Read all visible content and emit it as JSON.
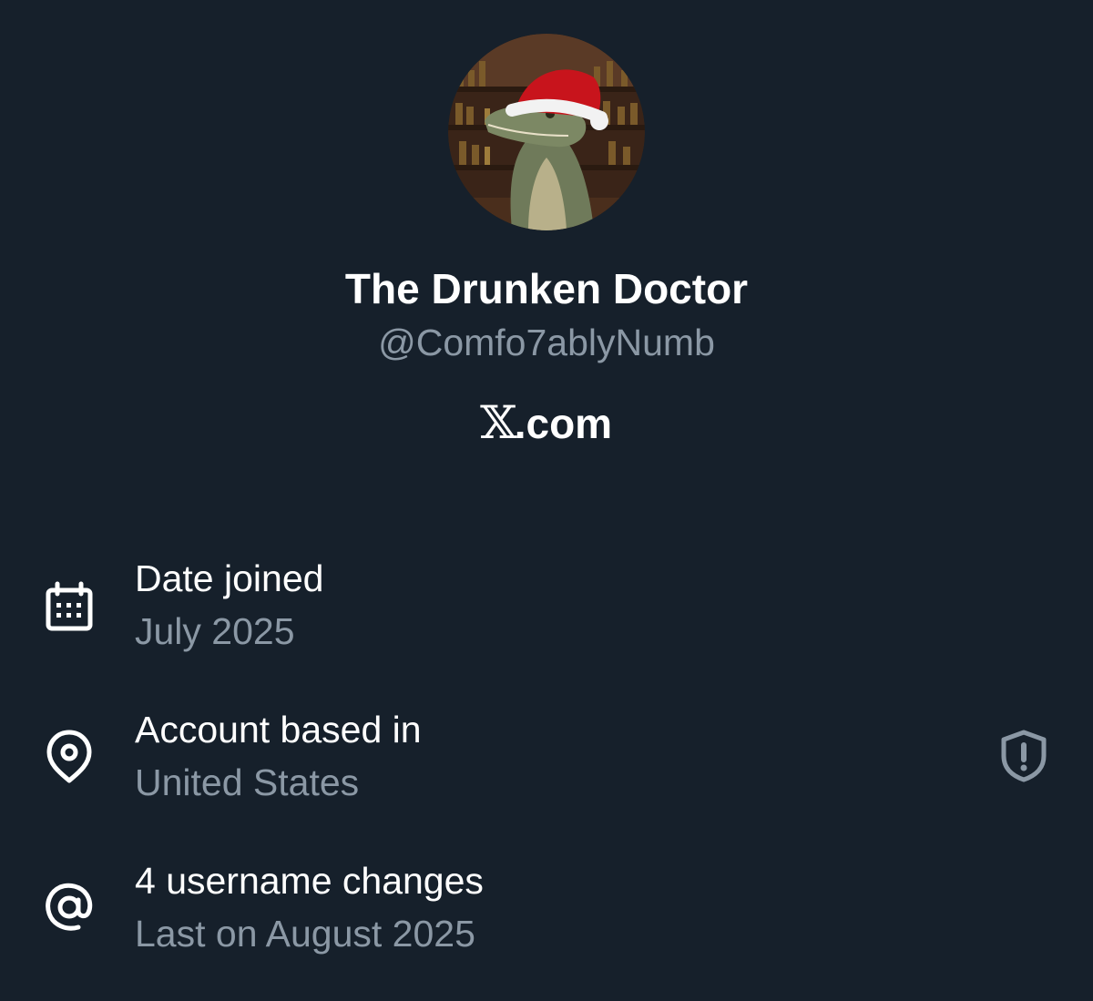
{
  "profile": {
    "display_name": "The Drunken Doctor",
    "handle": "@Comfo7ablyNumb",
    "site_mark": "𝕏",
    "site_suffix": ".com"
  },
  "info": {
    "date_joined": {
      "icon": "calendar-icon",
      "title": "Date joined",
      "value": "July 2025"
    },
    "account_location": {
      "icon": "location-pin-icon",
      "title": "Account based in",
      "value": "United States",
      "badge_icon": "shield-alert-icon"
    },
    "username_changes": {
      "icon": "at-sign-icon",
      "title": "4 username changes",
      "value": "Last on August 2025"
    }
  },
  "colors": {
    "background": "#16202b",
    "primary_text": "#ffffff",
    "secondary_text": "#8b98a5"
  }
}
